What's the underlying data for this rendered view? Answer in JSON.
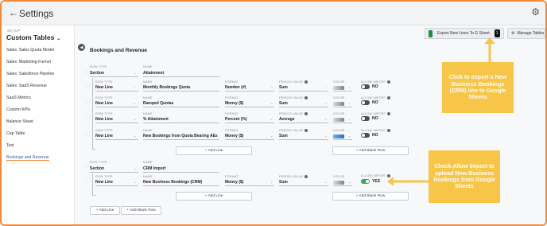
{
  "app": {
    "title": "Settings"
  },
  "sidebar": {
    "eyebrow": "SETUP",
    "title": "Custom Tables",
    "items": [
      "Sales: Sales Quota Model",
      "Sales: Marketing Funnel",
      "Sales: Salesforce Pipeline",
      "Sales: SaaS Revenue",
      "SaaS Metrics",
      "Custom KPIs",
      "Balance Sheet",
      "Cap Table",
      "Test",
      "Bookings and Revenue"
    ],
    "active_item": "Bookings and Revenue"
  },
  "toolbar": {
    "export_label": "Export New Lines To G Sheet",
    "export_badge": "1",
    "manage_label": "Manage Tables"
  },
  "panel": {
    "title": "Bookings and Revenue"
  },
  "labels": {
    "row_type": "ROW TYPE",
    "name": "NAME",
    "format": "FORMAT",
    "period_value": "PERIOD VALUE",
    "color": "COLOR",
    "allow_import": "ALLOW IMPORT"
  },
  "sections": [
    {
      "row_type": "Section",
      "name": "Attainment",
      "lines": [
        {
          "row_type": "New Line",
          "name": "Monthly Bookings Quota",
          "format": "Number (#)",
          "period_value": "Sum",
          "allow_import": "NO"
        },
        {
          "row_type": "New Line",
          "name": "Ramped Quotas",
          "format": "Money ($)",
          "period_value": "Sum",
          "allow_import": "NO"
        },
        {
          "row_type": "New Line",
          "name": "% Attainment",
          "format": "Percent (%)",
          "period_value": "Average",
          "allow_import": "NO"
        },
        {
          "row_type": "New Line",
          "name": "New Bookings from Quota Bearing AEs",
          "format": "Money ($)",
          "period_value": "Sum",
          "allow_import": "NO"
        }
      ]
    },
    {
      "row_type": "Section",
      "name": "CRM Import",
      "lines": [
        {
          "row_type": "New Line",
          "name": "New Business Bookings (CRM)",
          "format": "Money ($)",
          "period_value": "Sum",
          "allow_import": "YES"
        }
      ]
    }
  ],
  "buttons": {
    "add_line": "+ Add Line",
    "add_blank_row": "+ Add Blank Row"
  },
  "callouts": {
    "export": "Click to export a New Business Bookings (CRM) line to Google Sheets",
    "import": "Check Allow Import to upload New Business Bookings from Google Sheets"
  },
  "colors": {
    "accent": "#f0893a",
    "callout": "#f7c648",
    "toggle_on": "#3ea35e",
    "toggle_off": "#4b5058"
  }
}
